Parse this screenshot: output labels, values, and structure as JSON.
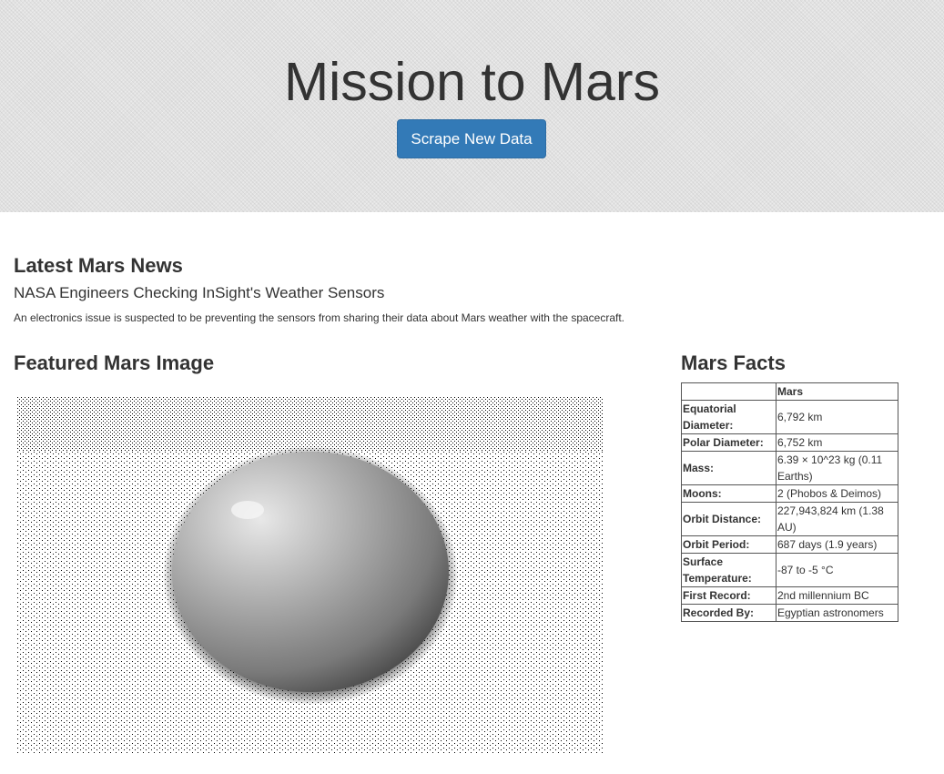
{
  "header": {
    "title": "Mission to Mars",
    "scrape_button_label": "Scrape New Data"
  },
  "news": {
    "section_heading": "Latest Mars News",
    "title": "NASA Engineers Checking InSight's Weather Sensors",
    "paragraph": "An electronics issue is suspected to be preventing the sensors from sharing their data about Mars weather with the spacecraft."
  },
  "featured": {
    "section_heading": "Featured Mars Image",
    "image_icon": "planet-image"
  },
  "facts": {
    "section_heading": "Mars Facts",
    "column_header": "Mars",
    "rows": [
      {
        "label": "Equatorial Diameter:",
        "value": "6,792 km"
      },
      {
        "label": "Polar Diameter:",
        "value": "6,752 km"
      },
      {
        "label": "Mass:",
        "value": "6.39 × 10^23 kg (0.11 Earths)"
      },
      {
        "label": "Moons:",
        "value": "2 (Phobos & Deimos)"
      },
      {
        "label": "Orbit Distance:",
        "value": "227,943,824 km (1.38 AU)"
      },
      {
        "label": "Orbit Period:",
        "value": "687 days (1.9 years)"
      },
      {
        "label": "Surface Temperature:",
        "value": "-87 to -5 °C"
      },
      {
        "label": "First Record:",
        "value": "2nd millennium BC"
      },
      {
        "label": "Recorded By:",
        "value": "Egyptian astronomers"
      }
    ]
  },
  "colors": {
    "button_primary": "#337ab7",
    "jumbotron_bg": "#e2e2e2"
  }
}
